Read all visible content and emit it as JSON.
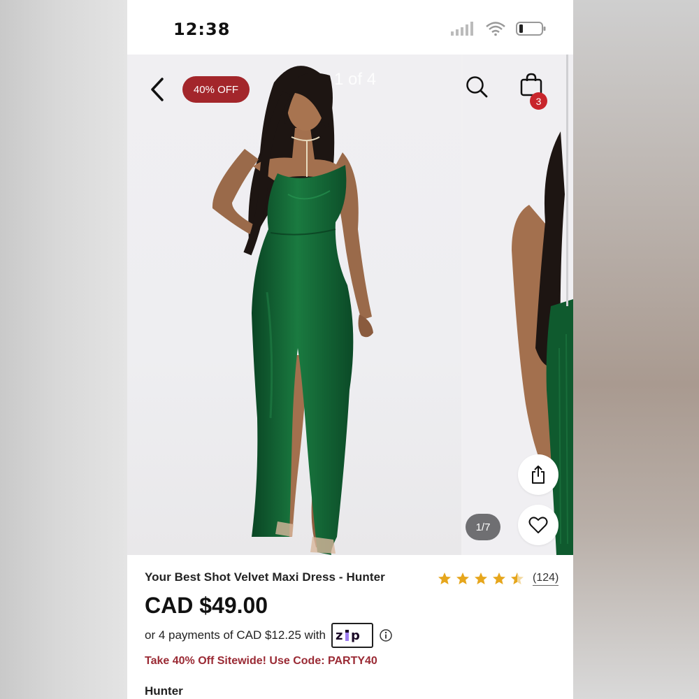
{
  "status_bar": {
    "time": "12:38",
    "icons": [
      "signal-icon",
      "wifi-icon",
      "battery-icon"
    ]
  },
  "header": {
    "back_icon": "chevron-left-icon",
    "discount_badge": "40% OFF",
    "page_counter": "1 of 4",
    "search_icon": "search-icon",
    "cart_icon": "shopping-bag-icon",
    "cart_count": "3"
  },
  "gallery": {
    "image_index": "1/7",
    "share_icon": "share-icon",
    "wishlist_icon": "heart-icon"
  },
  "product": {
    "title": "Your Best Shot Velvet Maxi Dress - Hunter",
    "rating": 4.5,
    "review_count": "(124)",
    "price": "CAD $49.00",
    "installments": "or 4 payments of CAD $12.25 with",
    "payment_provider": "zip",
    "info_icon": "info-icon",
    "promo": "Take 40% Off Sitewide! Use Code: PARTY40",
    "color": "Hunter"
  },
  "colors": {
    "discount_badge": "#a3262b",
    "cart_badge": "#c8252c",
    "star": "#e6a61c",
    "promo_text": "#9a2a34",
    "dress": "#0f5a2e"
  }
}
